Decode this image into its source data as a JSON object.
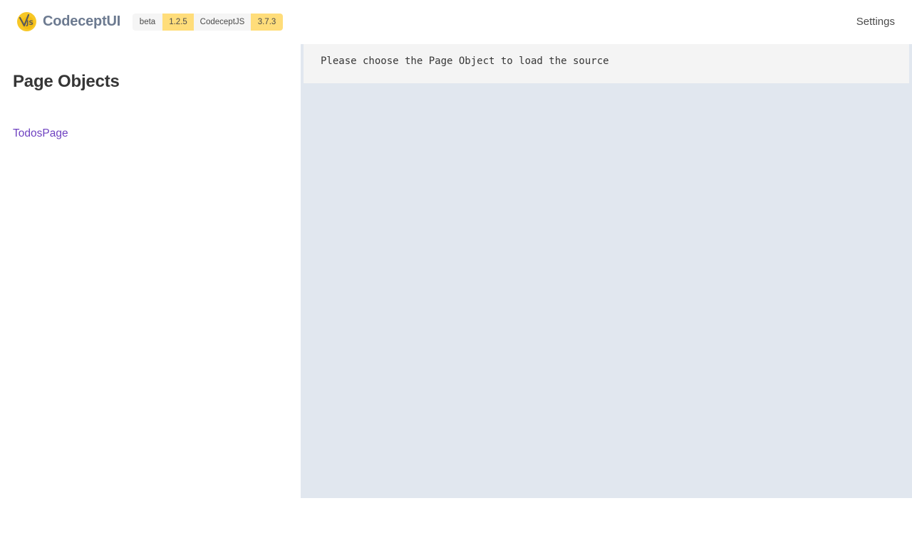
{
  "navbar": {
    "brand_name": "CodeceptUI",
    "logo_icon": "codeceptjs-logo-icon",
    "tags": {
      "beta_label": "beta",
      "ui_version": "1.2.5",
      "codeceptjs_label": "CodeceptJS",
      "codeceptjs_version": "3.7.3"
    },
    "settings_label": "Settings"
  },
  "sidebar": {
    "title": "Page Objects",
    "items": [
      {
        "label": "TodosPage"
      }
    ]
  },
  "main": {
    "placeholder_text": "Please choose the Page Object to load the source"
  },
  "colors": {
    "link": "#6f42c1",
    "brand_text": "#6c7a90",
    "tag_warning": "#ffdd7a",
    "tag_dark": "#f5f5f5",
    "main_background": "#e1e7ef",
    "source_background": "#f4f4f4"
  }
}
